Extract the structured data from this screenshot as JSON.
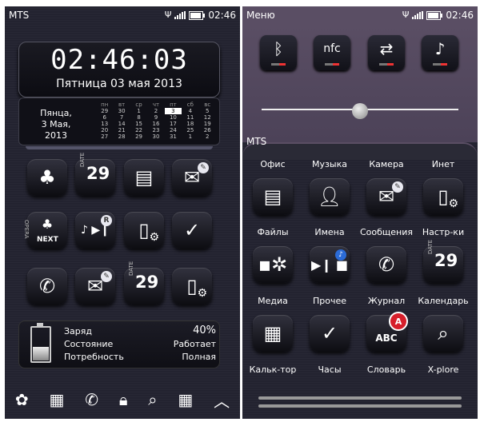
{
  "left_screen": {
    "status": {
      "carrier": "MTS",
      "time": "02:46"
    },
    "clock": {
      "time": "02:46:03",
      "date": "Пятница 03 мая 2013"
    },
    "calendar": {
      "day_text": [
        "Пянца,",
        "3 Мая,",
        "2013"
      ],
      "weekdays": [
        "пн",
        "вт",
        "ср",
        "чт",
        "пт",
        "сб",
        "вс"
      ],
      "weeks": [
        [
          "29",
          "30",
          "1",
          "2",
          "3",
          "4",
          "5"
        ],
        [
          "6",
          "7",
          "8",
          "9",
          "10",
          "11",
          "12"
        ],
        [
          "13",
          "14",
          "15",
          "16",
          "17",
          "18",
          "19"
        ],
        [
          "20",
          "21",
          "22",
          "23",
          "24",
          "25",
          "26"
        ],
        [
          "27",
          "28",
          "29",
          "30",
          "31",
          "1",
          "2"
        ]
      ],
      "highlight": "3"
    },
    "icons": {
      "date_num_1": "29",
      "date_label_1": "DATE",
      "opera_label": "OPERA",
      "next_label": "NEXT",
      "r_badge": "R",
      "date_num_2": "29",
      "date_label_2": "DATE"
    },
    "battery_widget": {
      "level_fraction": 0.4,
      "rows": [
        {
          "label": "Заряд",
          "value": "40%"
        },
        {
          "label": "Состояние",
          "value": "Работает"
        },
        {
          "label": "Потребность",
          "value": "Полная"
        }
      ]
    }
  },
  "right_screen": {
    "status": {
      "title": "Меню",
      "time": "02:46"
    },
    "quick_settings": {
      "nfc_label": "nfc"
    },
    "tab_label": "MTS",
    "top_labels": [
      "Офис",
      "Музыка",
      "Камера",
      "Инет"
    ],
    "row1_labels": [
      "Файлы",
      "Имена",
      "Сообщения",
      "Настр-ки"
    ],
    "row2_labels": [
      "Медиа",
      "Прочее",
      "Журнал",
      "Календарь"
    ],
    "row3_labels": [
      "Кальк-тор",
      "Часы",
      "Словарь",
      "X-plore"
    ],
    "icons": {
      "date_num": "29",
      "date_label": "DATE",
      "dict_text": "ABC",
      "dict_badge": "A"
    }
  }
}
